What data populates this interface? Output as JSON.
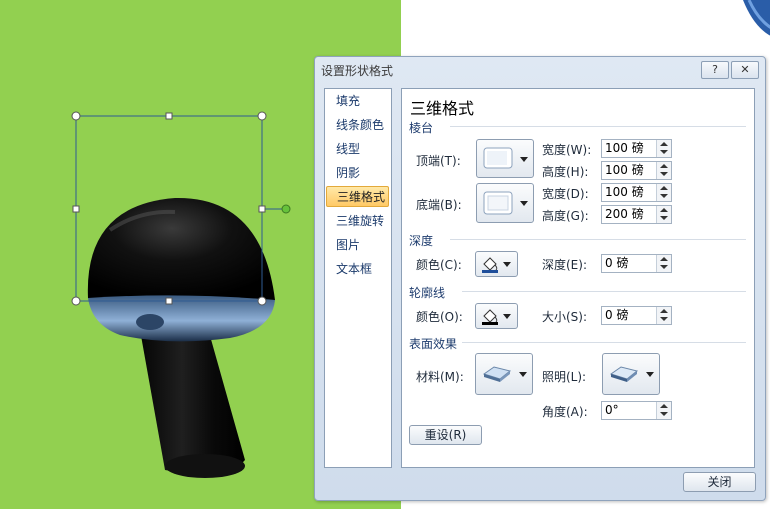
{
  "dialog": {
    "title": "设置形状格式",
    "help_label": "?",
    "close_x_label": "✕",
    "close_label": "关闭"
  },
  "nav": {
    "items": [
      {
        "label": "填充"
      },
      {
        "label": "线条颜色"
      },
      {
        "label": "线型"
      },
      {
        "label": "阴影"
      },
      {
        "label": "三维格式"
      },
      {
        "label": "三维旋转"
      },
      {
        "label": "图片"
      },
      {
        "label": "文本框"
      }
    ],
    "selected_index": 4
  },
  "panel": {
    "title": "三维格式",
    "bevel": {
      "section": "棱台",
      "top_label": "顶端(T):",
      "bottom_label": "底端(B):",
      "width_label": "宽度(W):",
      "height_label": "高度(H):",
      "width2_label": "宽度(D):",
      "height2_label": "高度(G):",
      "top_width": "100 磅",
      "top_height": "100 磅",
      "bottom_width": "100 磅",
      "bottom_height": "200 磅"
    },
    "depth": {
      "section": "深度",
      "color_label": "颜色(C):",
      "depth_label": "深度(E):",
      "depth_value": "0 磅",
      "color": "#1f4e9a"
    },
    "contour": {
      "section": "轮廓线",
      "color_label": "颜色(O):",
      "size_label": "大小(S):",
      "size_value": "0 磅",
      "color": "#000000"
    },
    "surface": {
      "section": "表面效果",
      "material_label": "材料(M):",
      "lighting_label": "照明(L):",
      "angle_label": "角度(A):",
      "angle_value": "0°"
    },
    "reset_label": "重设(R)"
  },
  "colors": {
    "canvas_bg": "#92d050",
    "shape_fill": "#0a0a0a",
    "selection": "#2f5b93",
    "rotate_handle": "#66c23b"
  },
  "icons": {
    "bevel_top": "bevel-icon",
    "bevel_bottom": "bevel-icon",
    "depth_color": "paint-bucket-icon",
    "contour_color": "paint-bucket-icon",
    "material": "material-icon",
    "lighting": "lighting-icon"
  }
}
